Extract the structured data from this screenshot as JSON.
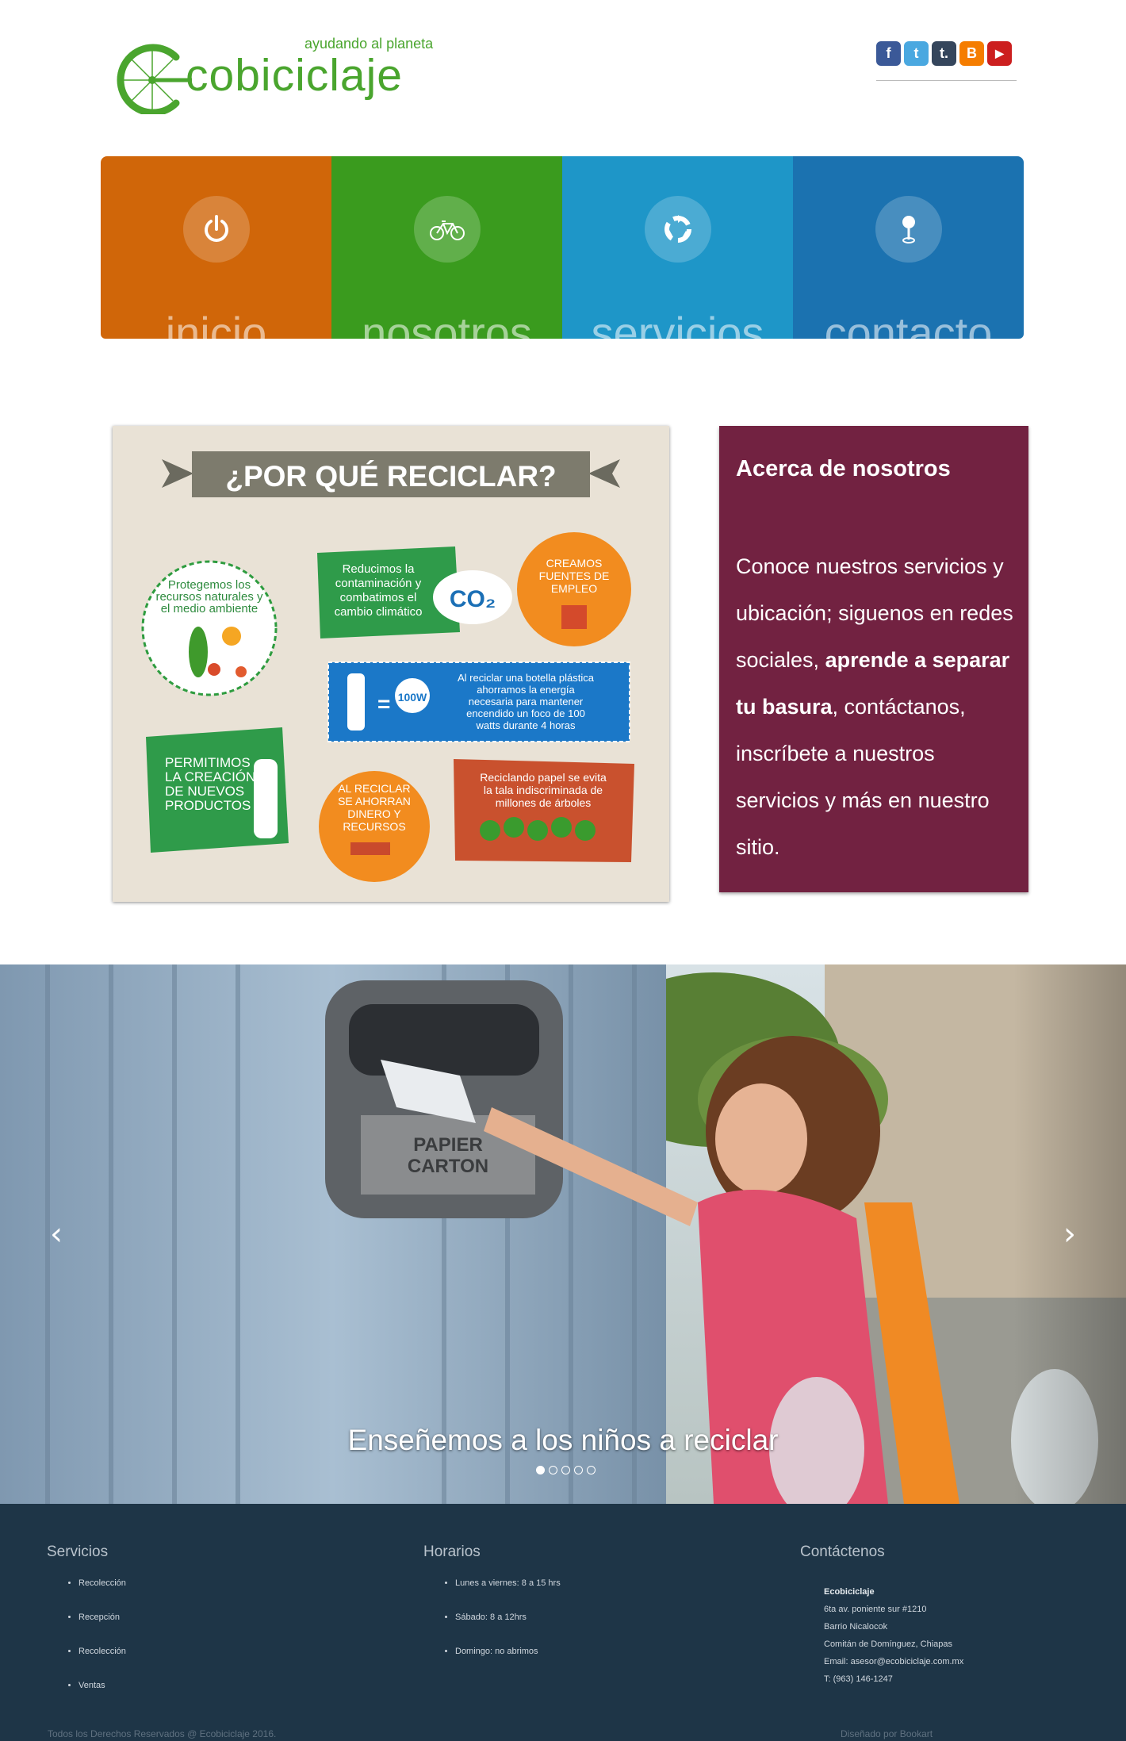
{
  "header": {
    "tagline": "ayudando al planeta",
    "brand": "cobiciclaje",
    "social_icons": [
      {
        "name": "facebook-icon",
        "glyph": "f",
        "color": "#3b5998"
      },
      {
        "name": "twitter-icon",
        "glyph": "t",
        "color": "#4aa8e0"
      },
      {
        "name": "tumblr-icon",
        "glyph": "t.",
        "color": "#35465c"
      },
      {
        "name": "blogger-icon",
        "glyph": "B",
        "color": "#f57d00"
      },
      {
        "name": "youtube-icon",
        "glyph": "▶",
        "color": "#cc1f1f"
      }
    ]
  },
  "nav": {
    "items": [
      {
        "label": "inicio",
        "color": "#d06609",
        "icon": "power-icon"
      },
      {
        "label": "nosotros",
        "color": "#3a9b1e",
        "icon": "bicycle-icon"
      },
      {
        "label": "servicios",
        "color": "#1e96c8",
        "icon": "recycle-icon"
      },
      {
        "label": "contacto",
        "color": "#1b72b0",
        "icon": "location-pin-icon"
      }
    ]
  },
  "infographic": {
    "title": "¿POR QUÉ RECICLAR?",
    "facts": [
      "Protegemos los recursos naturales y el medio ambiente",
      "Reducimos la contaminación y combatimos el cambio climático",
      "CO2",
      "CREAMOS FUENTES DE EMPLEO",
      "100 W",
      "Al reciclar una botella plástica ahorramos la energía necesaria para mantener encendido un foco de 100 watts durante 4 horas",
      "PERMITIMOS LA CREACIÓN DE NUEVOS PRODUCTOS",
      "AL RECICLAR SE AHORRAN DINERO Y RECURSOS",
      "Reciclando papel se evita la tala indiscriminada de millones de árboles"
    ]
  },
  "about": {
    "title": "Acerca de nosotros",
    "text_1": "Conoce nuestros servicios y ubicación; siguenos en redes sociales,",
    "text_bold": "aprende a separar tu basura",
    "text_2": ", contáctanos, inscríbete a nuestros servicios y más en nuestro sitio.",
    "background": "#722241"
  },
  "carousel": {
    "caption": "Enseñemos a los niños a reciclar",
    "bin_label": "PAPIER CARTON",
    "prev": "‹",
    "next": "›",
    "slide_count": 5,
    "active_index": 0
  },
  "footer": {
    "servicios": {
      "title": "Servicios",
      "items": [
        "Recolección",
        "Recepción",
        "Recolección",
        "Ventas"
      ]
    },
    "horarios": {
      "title": "Horarios",
      "items": [
        "Lunes a viernes: 8 a 15 hrs",
        "Sábado: 8 a 12hrs",
        "Domingo: no abrimos"
      ]
    },
    "contacto": {
      "title": "Contáctenos",
      "name": "Ecobiciclaje",
      "lines": [
        "6ta av. poniente sur #1210",
        "Barrio Nicalocok",
        "Comitán de Domínguez, Chiapas",
        "Email: asesor@ecobiciclaje.com.mx",
        "T: (963) 146-1247"
      ]
    },
    "copyright": "Todos los Derechos Reservados @ Ecobiciclaje 2016.",
    "designer": "Diseñado por Bookart",
    "background": "#1e3547"
  }
}
